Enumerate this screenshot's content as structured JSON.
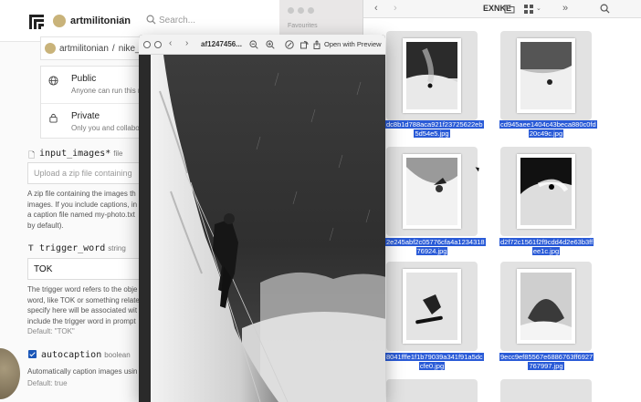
{
  "web": {
    "user": "artmilitonian",
    "search_placeholder": "Search...",
    "breadcrumb": {
      "owner": "artmilitonian",
      "separator": "/",
      "model": "nike_m"
    },
    "visibility": [
      {
        "title": "Public",
        "desc": "Anyone can run this m"
      },
      {
        "title": "Private",
        "desc": "Only you and collabor"
      }
    ],
    "input_images": {
      "label": "input_images*",
      "type": "file",
      "placeholder": "Upload a zip file containing",
      "help": [
        "A zip file containing the images th",
        "images. If you include captions, in",
        "a caption file named my-photo.txt",
        "by default)."
      ]
    },
    "trigger_word": {
      "label": "trigger_word",
      "type": "string",
      "value": "TOK",
      "help": [
        "The trigger word refers to the obje",
        "word, like TOK or something relate",
        "specify here will be associated wit",
        "include the trigger word in prompt"
      ],
      "default": "Default: \"TOK\""
    },
    "autocaption": {
      "label": "autocaption",
      "type": "boolean",
      "help": "Automatically caption images usin",
      "default": "Default: true"
    }
  },
  "finder": {
    "sidebar_heading": "Favourites",
    "sidebar_item": "",
    "title": "EXNKE",
    "files": [
      [
        "dc8b1d788aca921f23725622eb",
        "5d54e5.jpg"
      ],
      [
        "cd945aee1404c43beca880c0fd",
        "20c49c.jpg"
      ],
      [
        "2e245abf2c05776cfa4a1234318",
        "76924.jpg"
      ],
      [
        "d2f72c1561f2f9cdd4d2e63b3ff",
        "ee1c.jpg"
      ],
      [
        "8041fffe1f1b79039a341f91a5dc",
        "cfe0.jpg"
      ],
      [
        "9ecc9ef85567e6886763ff6927",
        "767997.jpg"
      ]
    ]
  },
  "preview": {
    "title": "af1247456...",
    "open_with": "Open with Preview"
  },
  "colors": {
    "selection": "#2a5bd7",
    "checkbox": "#1a56b8"
  }
}
